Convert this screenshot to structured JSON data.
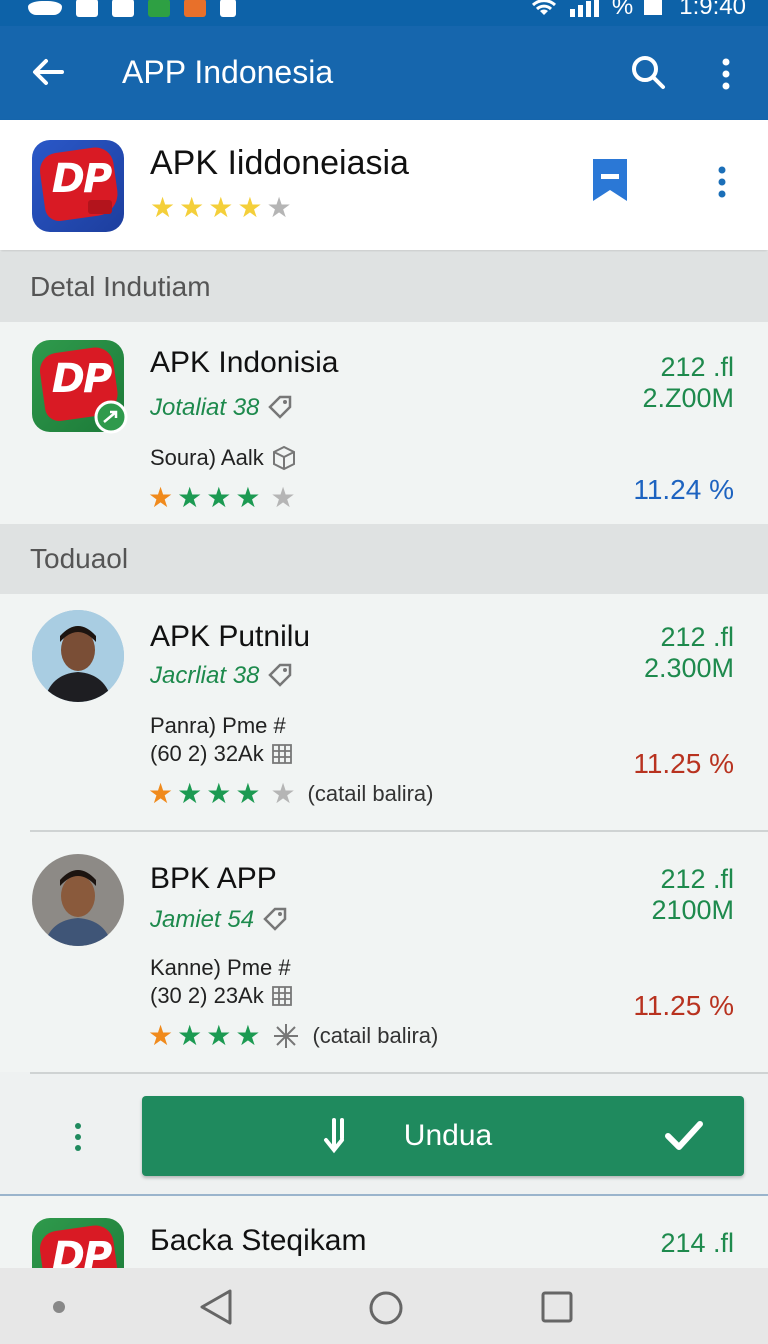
{
  "status_bar": {
    "signal_text": "%",
    "time": "1:9:40"
  },
  "app_bar": {
    "title": "APP Indonesia"
  },
  "header": {
    "icon_text": "DP",
    "title": "APK Iiddoneiasia",
    "rating_stars": 4,
    "star_color": "#f4cf3a"
  },
  "sections": [
    {
      "label": "Detal Indutiam"
    },
    {
      "label": "Toduaol"
    }
  ],
  "apps": [
    {
      "title": "APK Indonisia",
      "subtitle": "Jotaliat 38",
      "desc_lines": [
        "Soura) Aalk"
      ],
      "stat_top": "212 .fl",
      "stat_bottom": "2.Z00M",
      "percent": "11.24 %",
      "percent_color": "#1d63c0",
      "rating_stars": 4,
      "rating_note": "",
      "icon_text": "DP"
    },
    {
      "title": "APK Putnilu",
      "subtitle": "Jacrliat 38",
      "desc_lines": [
        "Panra) Pme #",
        "(60 2) 32Ak"
      ],
      "stat_top": "212 .fl",
      "stat_bottom": "2.300M",
      "percent": "11.25 %",
      "percent_color": "#b8321f",
      "rating_stars": 4,
      "rating_note": "(catail balira)"
    },
    {
      "title": "BPK APP",
      "subtitle": "Jamiet 54",
      "desc_lines": [
        "Kanne) Pme #",
        "(30 2) 23Ak"
      ],
      "stat_top": "212 .fl",
      "stat_bottom": "2100M",
      "percent": "11.25 %",
      "percent_color": "#b8321f",
      "rating_stars": 4,
      "rating_note": "(catail balira)"
    }
  ],
  "download": {
    "label": "Undua"
  },
  "bottom_row": {
    "title": "Бacka Steqikam",
    "stat_top": "214 .fl",
    "icon_text": "DP"
  }
}
